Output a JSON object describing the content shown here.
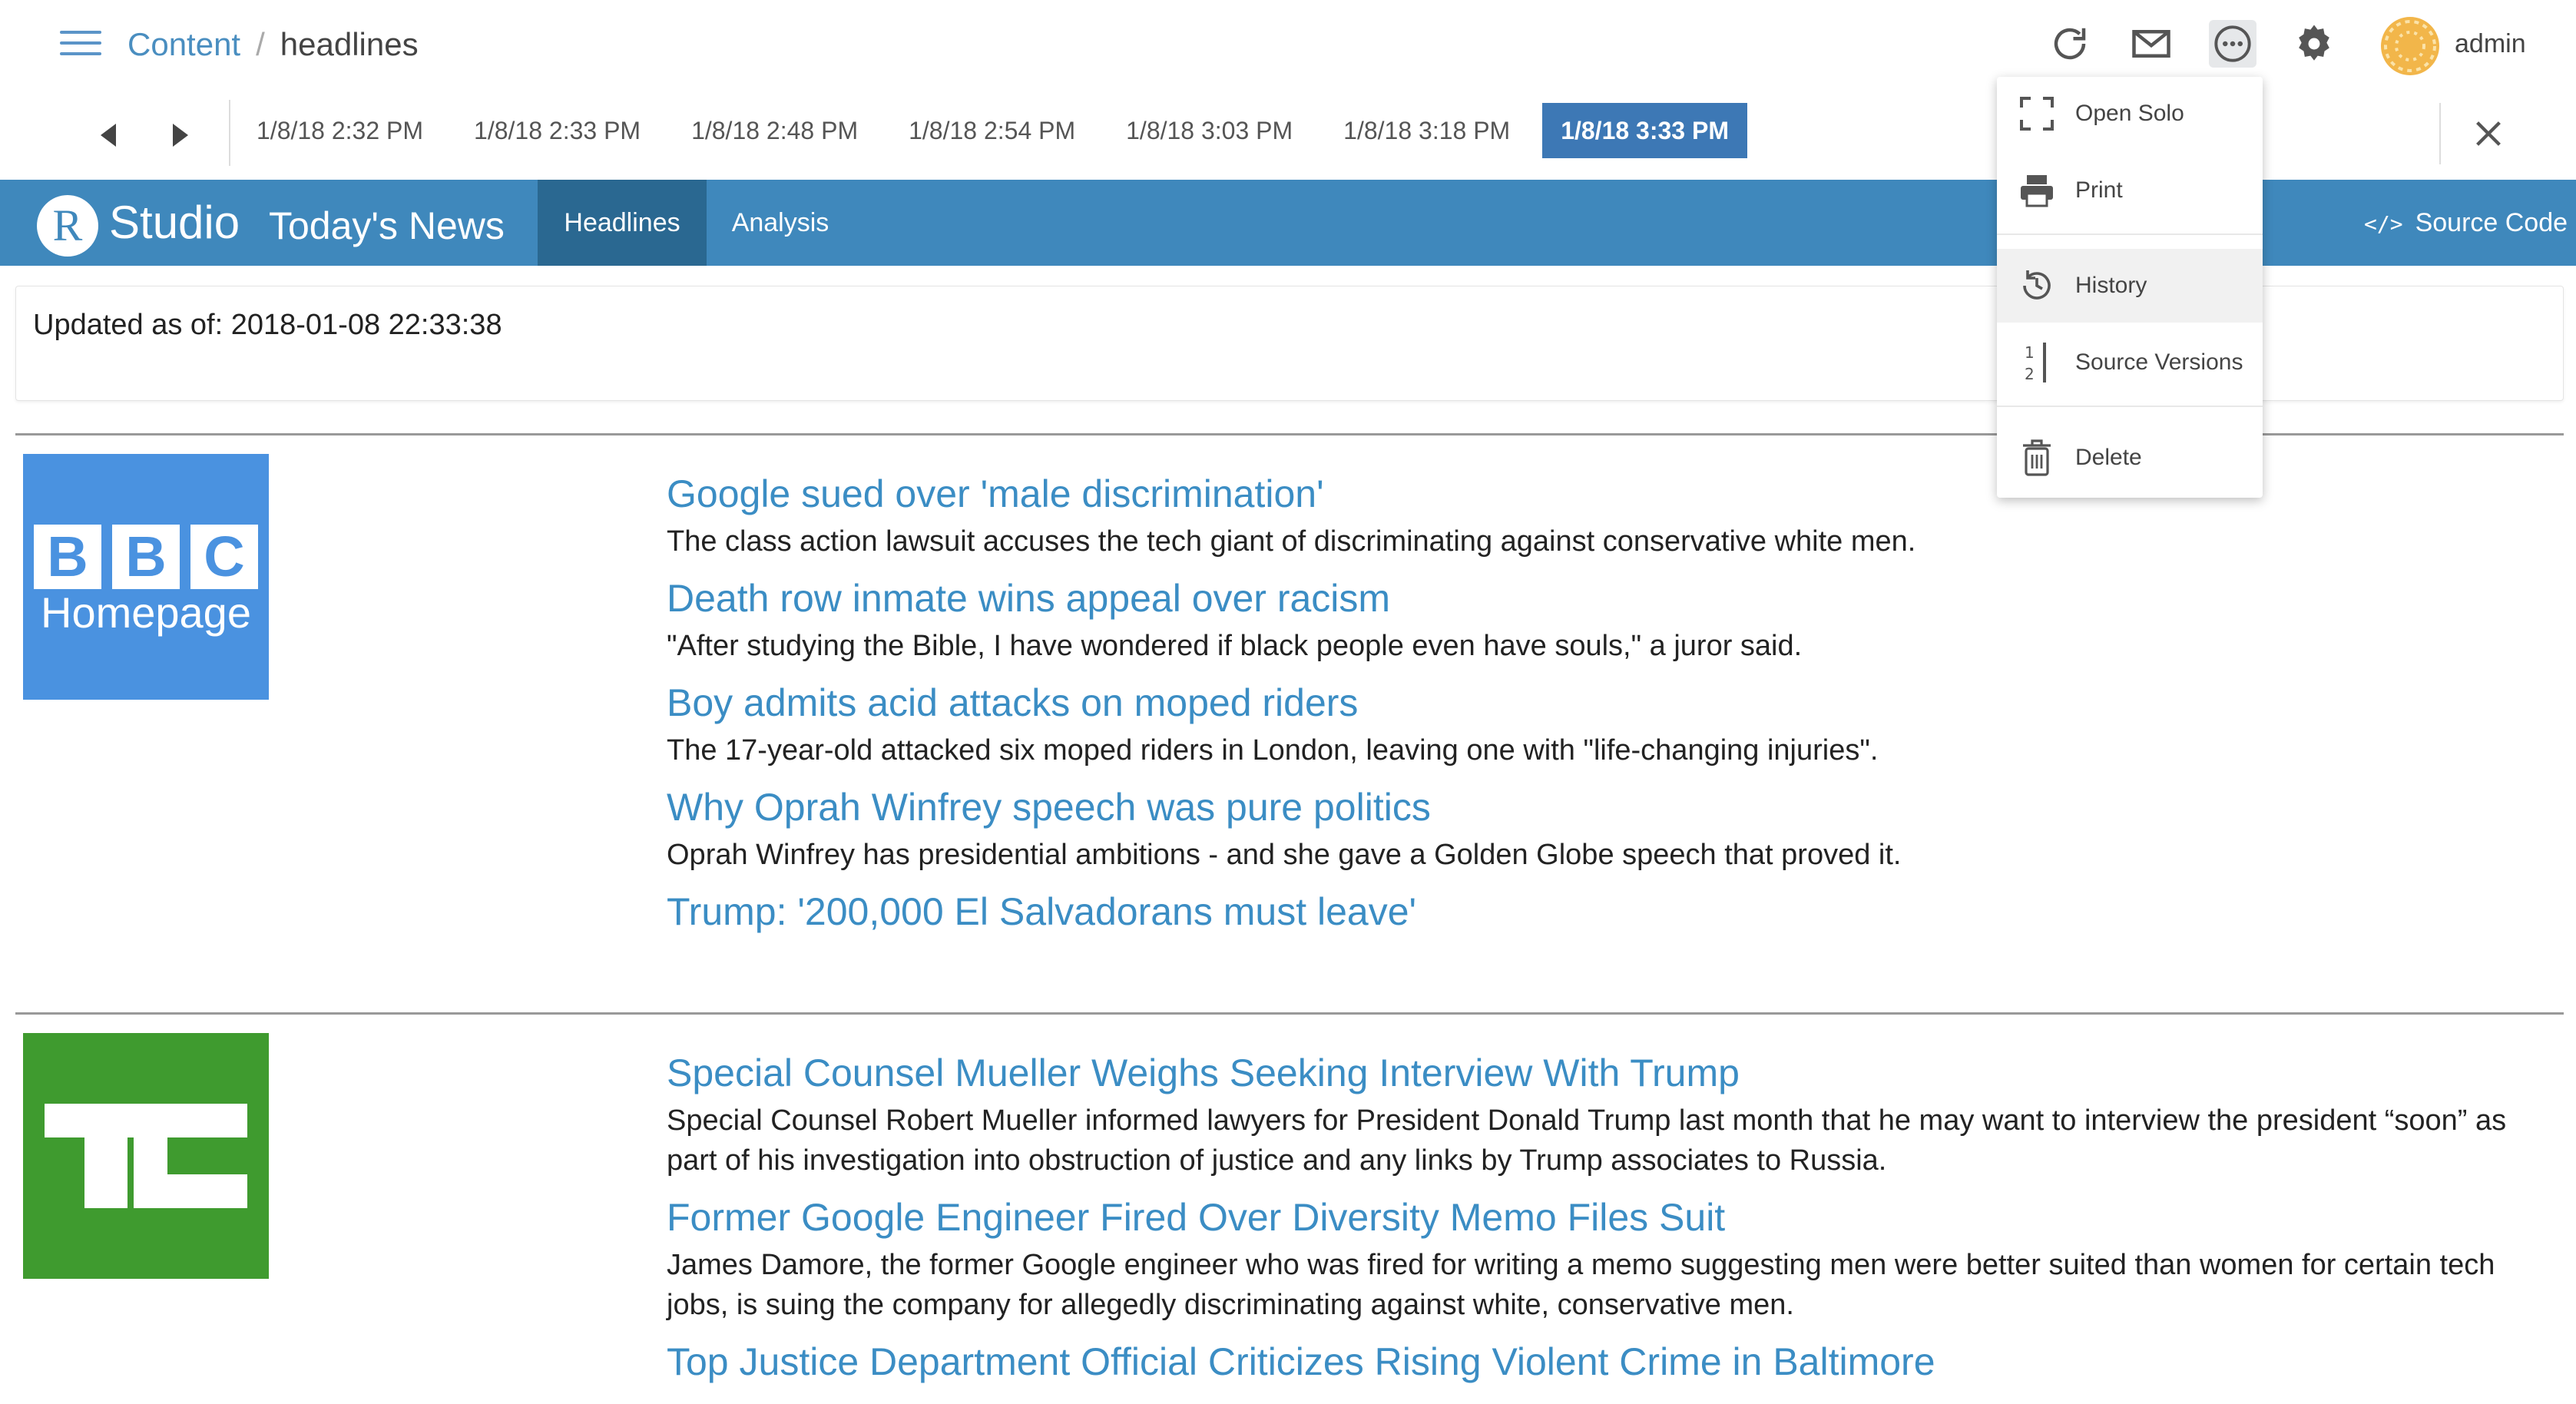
{
  "topbar": {
    "breadcrumb_root": "Content",
    "breadcrumb_sep": "/",
    "breadcrumb_current": "headlines",
    "username": "admin"
  },
  "history": {
    "versions": [
      "1/8/18 2:32 PM",
      "1/8/18 2:33 PM",
      "1/8/18 2:48 PM",
      "1/8/18 2:54 PM",
      "1/8/18 3:03 PM",
      "1/8/18 3:18 PM",
      "1/8/18 3:33 PM"
    ],
    "active_version": "1/8/18 3:33 PM"
  },
  "app": {
    "logo_letter": "R",
    "logo_text": "Studio",
    "title": "Today's News",
    "tabs": [
      {
        "label": "Headlines",
        "active": true
      },
      {
        "label": "Analysis",
        "active": false
      }
    ],
    "source_code_label": "Source Code"
  },
  "updated": "Updated as of: 2018-01-08 22:33:38",
  "sources": [
    {
      "logo_line1": "BBC",
      "logo_line2": "Homepage",
      "logo_color": "#4a92e0",
      "items": [
        {
          "headline": "Google sued over 'male discrimination'",
          "summary": "The class action lawsuit accuses the tech giant of discriminating against conservative white men."
        },
        {
          "headline": "Death row inmate wins appeal over racism",
          "summary": "\"After studying the Bible, I have wondered if black people even have souls,\" a juror said."
        },
        {
          "headline": "Boy admits acid attacks on moped riders",
          "summary": "The 17-year-old attacked six moped riders in London, leaving one with \"life-changing injuries\"."
        },
        {
          "headline": "Why Oprah Winfrey speech was pure politics",
          "summary": "Oprah Winfrey has presidential ambitions - and she gave a Golden Globe speech that proved it."
        },
        {
          "headline": "Trump: '200,000 El Salvadorans must leave'",
          "summary": ""
        }
      ]
    },
    {
      "logo_color": "#3f9b2f",
      "items": [
        {
          "headline": "Special Counsel Mueller Weighs Seeking Interview With Trump",
          "summary": "Special Counsel Robert Mueller informed lawyers for President Donald Trump last month that he may want to interview the president “soon” as part of his investigation into obstruction of justice and any links by Trump associates to Russia."
        },
        {
          "headline": "Former Google Engineer Fired Over Diversity Memo Files Suit",
          "summary": "James Damore, the former Google engineer who was fired for writing a memo suggesting men were better suited than women for certain tech jobs, is suing the company for allegedly discriminating against white, conservative men."
        },
        {
          "headline": "Top Justice Department Official Criticizes Rising Violent Crime in Baltimore",
          "summary": ""
        }
      ]
    }
  ],
  "dropdown": {
    "items": [
      {
        "label": "Open Solo",
        "icon": "expand-icon"
      },
      {
        "label": "Print",
        "icon": "printer-icon"
      },
      {
        "label": "History",
        "icon": "history-icon"
      },
      {
        "label": "Source Versions",
        "icon": "versions-icon"
      },
      {
        "label": "Delete",
        "icon": "trash-icon"
      }
    ]
  },
  "colors": {
    "nav_bg": "#3f88bc",
    "nav_active": "#2a6891",
    "version_active": "#3d78b5",
    "link": "#3b8dc4"
  }
}
